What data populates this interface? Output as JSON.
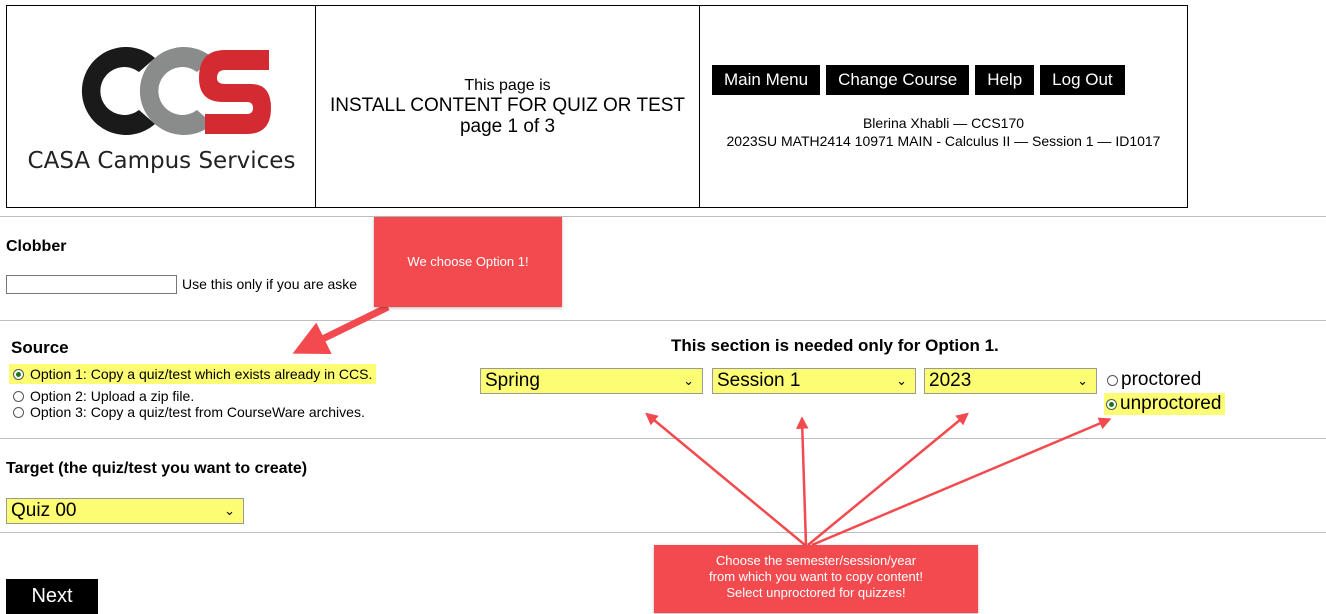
{
  "header": {
    "logo_text": "CCS",
    "logo_caption": "CASA Campus Services",
    "page_intro": "This page is",
    "page_title": "INSTALL CONTENT FOR QUIZ OR TEST",
    "page_progress": "page 1 of 3",
    "nav": {
      "main_menu": "Main Menu",
      "change_course": "Change Course",
      "help": "Help",
      "log_out": "Log Out"
    },
    "user_line": "Blerina Xhabli — CCS170",
    "course_line": "2023SU MATH2414 10971 MAIN - Calculus II — Session 1 — ID1017"
  },
  "clobber": {
    "heading": "Clobber",
    "input_value": "",
    "hint": "Use this only if you are aske"
  },
  "source": {
    "heading": "Source",
    "options": [
      {
        "label": "Option 1: Copy a quiz/test which exists already in CCS.",
        "selected": true
      },
      {
        "label": "Option 2: Upload a zip file.",
        "selected": false
      },
      {
        "label": "Option 3: Copy a quiz/test from CourseWare archives.",
        "selected": false
      }
    ]
  },
  "option1_section": {
    "heading": "This section is needed only for Option 1.",
    "semester": "Spring",
    "session": "Session 1",
    "year": "2023",
    "proctored_label": "proctored",
    "unproctored_label": "unproctored",
    "proctoring_selected": "unproctored"
  },
  "target": {
    "heading": "Target (the quiz/test you want to create)",
    "selected": "Quiz 00"
  },
  "next_button": "Next",
  "annotations": {
    "callout_option1": "We choose Option 1!",
    "callout_semester_l1": "Choose the semester/session/year",
    "callout_semester_l2": "from which you want to copy content!",
    "callout_semester_l3": "Select unproctored for quizzes!"
  },
  "colors": {
    "highlight": "#fdfd73",
    "callout": "#f24a4f",
    "logo_dark": "#1a1a1a",
    "logo_gray": "#8a8c8c",
    "logo_red": "#d42a32"
  }
}
